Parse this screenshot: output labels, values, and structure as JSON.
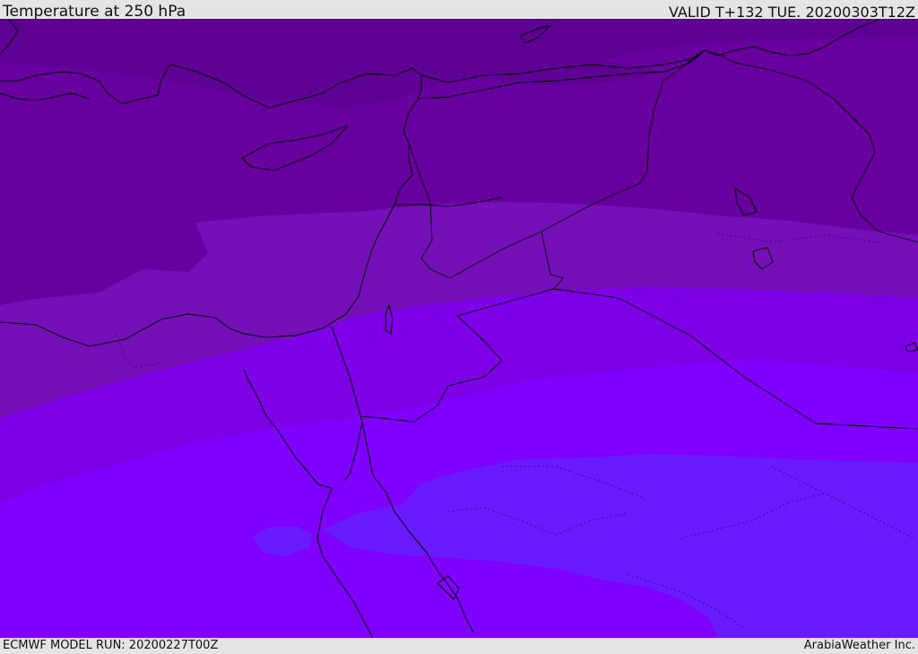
{
  "header": {
    "title": "Temperature at 250 hPa",
    "valid": "VALID T+132 TUE. 20200303T12Z"
  },
  "footer": {
    "model_run": "ECMWF MODEL RUN: 20200227T00Z",
    "credit": "ArabiaWeather Inc."
  },
  "colors": {
    "band_coldest": "#5e0094",
    "band_cold": "#67009e",
    "band_mid": "#7510b8",
    "band_warm": "#7d00e6",
    "band_warmer": "#7f00ff",
    "band_warmest": "#6a1aff",
    "coast": "#000000",
    "bar_bg": "#e4e4e4"
  }
}
